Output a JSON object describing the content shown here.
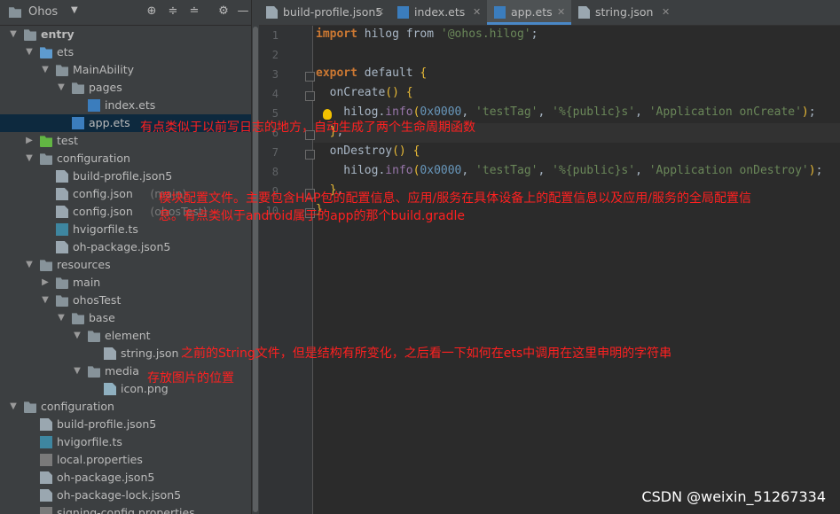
{
  "project": {
    "name": "Ohos"
  },
  "tree": [
    {
      "label": "entry",
      "bold": true,
      "kind": "folder-mod",
      "level": 0,
      "open": true
    },
    {
      "label": "ets",
      "kind": "folder-blue",
      "level": 1,
      "open": true
    },
    {
      "label": "MainAbility",
      "kind": "folder",
      "level": 2,
      "open": true
    },
    {
      "label": "pages",
      "kind": "folder",
      "level": 3,
      "open": true
    },
    {
      "label": "index.ets",
      "kind": "ets",
      "level": 4
    },
    {
      "label": "app.ets",
      "kind": "ets",
      "level": 3,
      "selected": true
    },
    {
      "label": "test",
      "kind": "folder-green",
      "level": 1,
      "open": false
    },
    {
      "label": "configuration",
      "kind": "folder",
      "level": 1,
      "open": true
    },
    {
      "label": "build-profile.json5",
      "kind": "json",
      "level": 2
    },
    {
      "label": "config.json",
      "sub": "(main)",
      "kind": "json",
      "level": 2
    },
    {
      "label": "config.json",
      "sub": "(ohosTest)",
      "kind": "json",
      "level": 2
    },
    {
      "label": "hvigorfile.ts",
      "kind": "ts",
      "level": 2
    },
    {
      "label": "oh-package.json5",
      "kind": "json",
      "level": 2
    },
    {
      "label": "resources",
      "kind": "folder",
      "level": 1,
      "open": true
    },
    {
      "label": "main",
      "kind": "folder",
      "level": 2,
      "open": false
    },
    {
      "label": "ohosTest",
      "kind": "folder",
      "level": 2,
      "open": true
    },
    {
      "label": "base",
      "kind": "folder",
      "level": 3,
      "open": true
    },
    {
      "label": "element",
      "kind": "folder",
      "level": 4,
      "open": true
    },
    {
      "label": "string.json",
      "kind": "json",
      "level": 5
    },
    {
      "label": "media",
      "kind": "folder",
      "level": 4,
      "open": true
    },
    {
      "label": "icon.png",
      "kind": "png",
      "level": 5
    },
    {
      "label": "configuration",
      "kind": "folder",
      "level": 0,
      "open": true
    },
    {
      "label": "build-profile.json5",
      "kind": "json",
      "level": 1
    },
    {
      "label": "hvigorfile.ts",
      "kind": "ts",
      "level": 1
    },
    {
      "label": "local.properties",
      "kind": "prop",
      "level": 1
    },
    {
      "label": "oh-package.json5",
      "kind": "json",
      "level": 1
    },
    {
      "label": "oh-package-lock.json5",
      "kind": "json",
      "level": 1
    },
    {
      "label": "signing-config.properties",
      "kind": "prop",
      "level": 1
    }
  ],
  "tabs": [
    {
      "label": "build-profile.json5",
      "kind": "json",
      "active": false
    },
    {
      "label": "index.ets",
      "kind": "ets",
      "active": false
    },
    {
      "label": "app.ets",
      "kind": "ets",
      "active": true
    },
    {
      "label": "string.json",
      "kind": "json",
      "active": false
    }
  ],
  "code": {
    "line_numbers": [
      "1",
      "2",
      "3",
      "4",
      "5",
      "6",
      "7",
      "8",
      "9",
      "10"
    ],
    "lines": [
      "import hilog from '@ohos.hilog';",
      "",
      "export default {",
      "  onCreate() {",
      "    hilog.info(0x0000, 'testTag', '%{public}s', 'Application onCreate');",
      "  },",
      "  onDestroy() {",
      "    hilog.info(0x0000, 'testTag', '%{public}s', 'Application onDestroy');",
      "  },",
      "}"
    ]
  },
  "annotations": {
    "app_ets": "有点类似于以前写日志的地方，自动生成了两个生命周期函数",
    "config_line1": "模块配置文件。主要包含HAP包的配置信息、应用/服务在具体设备上的配置信息以及应用/服务的全局配置信",
    "config_line2": "息。有点类似于android属于的app的那个build.gradle",
    "string_json": "之前的String文件，但是结构有所变化，之后看一下如何在ets中调用在这里申明的字符串",
    "media": "存放图片的位置"
  },
  "watermark": "CSDN @weixin_51267334"
}
